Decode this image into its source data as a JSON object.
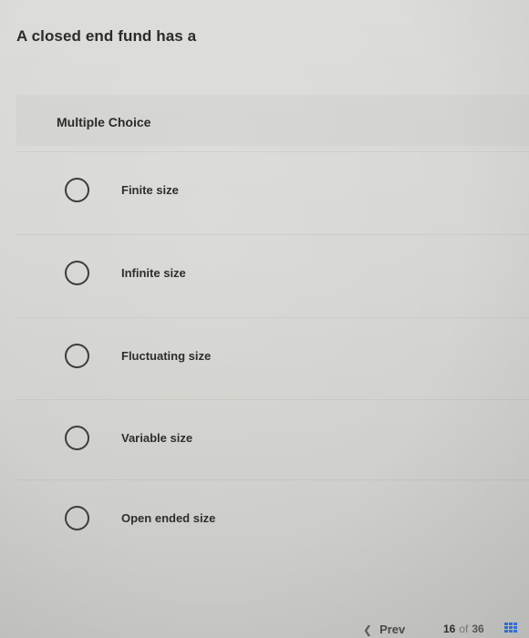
{
  "question": {
    "text": "A closed end fund has a"
  },
  "multiple_choice": {
    "header": "Multiple Choice",
    "options": [
      {
        "label": "Finite size"
      },
      {
        "label": "Infinite size"
      },
      {
        "label": "Fluctuating size"
      },
      {
        "label": "Variable size"
      },
      {
        "label": "Open ended size"
      }
    ]
  },
  "footer": {
    "prev_label": "Prev",
    "current_page": "16",
    "of_text": "of",
    "total_pages": "36",
    "grid_icon": "grid-icon"
  },
  "colors": {
    "grid_icon": "#2f6fd6"
  }
}
